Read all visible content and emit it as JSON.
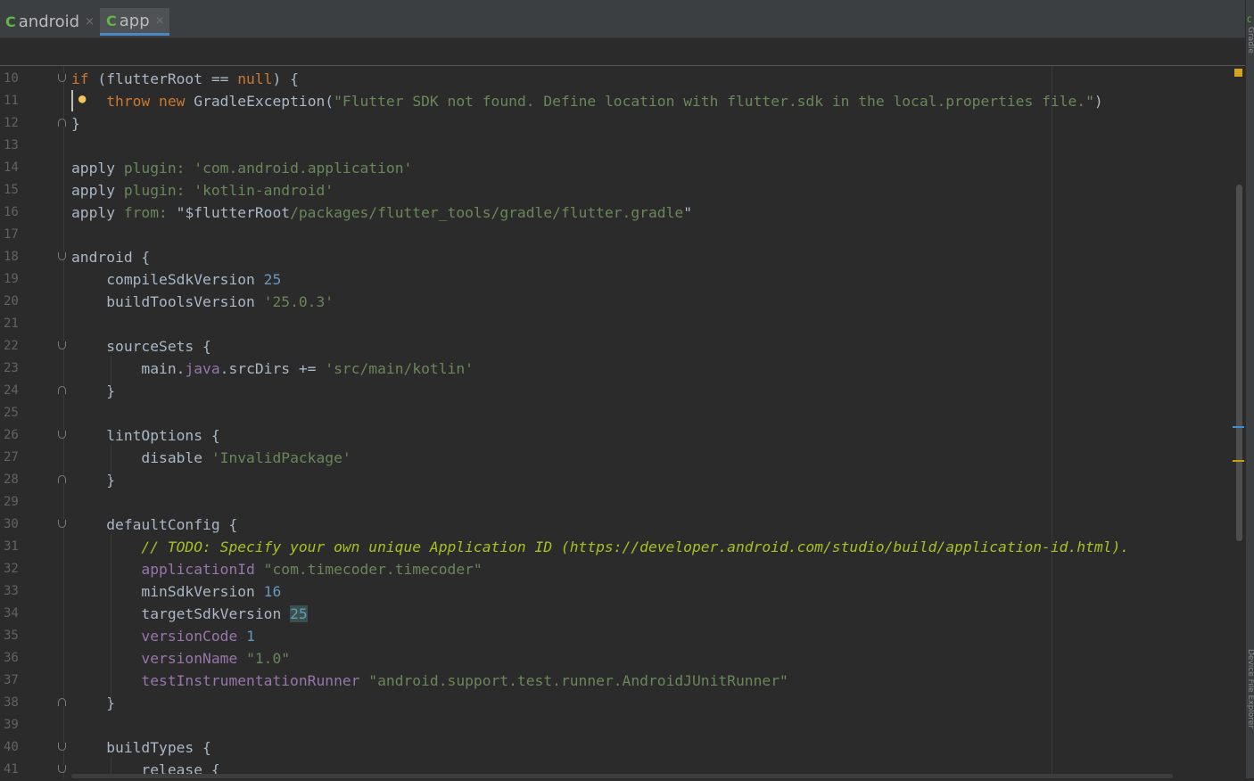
{
  "tabs": [
    {
      "label": "android",
      "close": "×",
      "icon": "gradle-c-icon",
      "active": false
    },
    {
      "label": "app",
      "close": "×",
      "icon": "gradle-c-icon",
      "active": true
    }
  ],
  "side_panel": {
    "top_label": "Gradle",
    "bottom_label": "Device File Explorer"
  },
  "colors": {
    "background": "#2b2b2b",
    "keyword": "#cc7832",
    "string": "#6a8759",
    "number": "#6897bb",
    "property": "#9876aa",
    "todo": "#a8c023",
    "text": "#a9b7c6"
  },
  "code": {
    "lines": [
      {
        "num": "10",
        "tokens": [
          {
            "t": "if",
            "c": "keyword"
          },
          {
            "t": " (flutterRoot == "
          },
          {
            "t": "null",
            "c": "keyword"
          },
          {
            "t": ") {"
          }
        ]
      },
      {
        "num": "11",
        "tokens": [
          {
            "t": "    "
          },
          {
            "t": "throw",
            "c": "keyword"
          },
          {
            "t": " "
          },
          {
            "t": "new",
            "c": "keyword"
          },
          {
            "t": " GradleException("
          },
          {
            "t": "\"Flutter SDK not found. Define location with flutter.sdk in the local.properties file.\"",
            "c": "string"
          },
          {
            "t": ")"
          }
        ]
      },
      {
        "num": "12",
        "tokens": [
          {
            "t": "}"
          }
        ]
      },
      {
        "num": "13",
        "tokens": []
      },
      {
        "num": "14",
        "tokens": [
          {
            "t": "apply "
          },
          {
            "t": "plugin:",
            "c": "string"
          },
          {
            "t": " "
          },
          {
            "t": "'com.android.application'",
            "c": "string"
          }
        ]
      },
      {
        "num": "15",
        "tokens": [
          {
            "t": "apply "
          },
          {
            "t": "plugin:",
            "c": "string"
          },
          {
            "t": " "
          },
          {
            "t": "'kotlin-android'",
            "c": "string"
          }
        ]
      },
      {
        "num": "16",
        "tokens": [
          {
            "t": "apply "
          },
          {
            "t": "from:",
            "c": "string"
          },
          {
            "t": " \"$flutterRoot"
          },
          {
            "t": "/packages/flutter_tools/gradle/flutter.gradle",
            "c": "string"
          },
          {
            "t": "\""
          }
        ]
      },
      {
        "num": "17",
        "tokens": []
      },
      {
        "num": "18",
        "tokens": [
          {
            "t": "android {"
          }
        ]
      },
      {
        "num": "19",
        "tokens": [
          {
            "t": "    compileSdkVersion "
          },
          {
            "t": "25",
            "c": "number"
          }
        ]
      },
      {
        "num": "20",
        "tokens": [
          {
            "t": "    buildToolsVersion "
          },
          {
            "t": "'25.0.3'",
            "c": "string"
          }
        ]
      },
      {
        "num": "21",
        "tokens": []
      },
      {
        "num": "22",
        "tokens": [
          {
            "t": "    sourceSets {"
          }
        ]
      },
      {
        "num": "23",
        "tokens": [
          {
            "t": "        main."
          },
          {
            "t": "java",
            "c": "property"
          },
          {
            "t": ".srcDirs += "
          },
          {
            "t": "'src/main/kotlin'",
            "c": "string"
          }
        ]
      },
      {
        "num": "24",
        "tokens": [
          {
            "t": "    }"
          }
        ]
      },
      {
        "num": "25",
        "tokens": []
      },
      {
        "num": "26",
        "tokens": [
          {
            "t": "    lintOptions {"
          }
        ]
      },
      {
        "num": "27",
        "tokens": [
          {
            "t": "        disable "
          },
          {
            "t": "'InvalidPackage'",
            "c": "string"
          }
        ]
      },
      {
        "num": "28",
        "tokens": [
          {
            "t": "    }"
          }
        ]
      },
      {
        "num": "29",
        "tokens": []
      },
      {
        "num": "30",
        "tokens": [
          {
            "t": "    defaultConfig {"
          }
        ]
      },
      {
        "num": "31",
        "tokens": [
          {
            "t": "        // ",
            "c": "comment"
          },
          {
            "t": "TODO: Specify your own unique Application ID (https://developer.android.com/studio/build/application-id.html).",
            "c": "todo"
          }
        ]
      },
      {
        "num": "32",
        "tokens": [
          {
            "t": "        "
          },
          {
            "t": "applicationId",
            "c": "property"
          },
          {
            "t": " "
          },
          {
            "t": "\"com.timecoder.timecoder\"",
            "c": "string"
          }
        ]
      },
      {
        "num": "33",
        "tokens": [
          {
            "t": "        minSdkVersion "
          },
          {
            "t": "16",
            "c": "number"
          }
        ]
      },
      {
        "num": "34",
        "tokens": [
          {
            "t": "        targetSdkVersion "
          },
          {
            "t": "25",
            "c": "numberhl"
          }
        ]
      },
      {
        "num": "35",
        "tokens": [
          {
            "t": "        "
          },
          {
            "t": "versionCode",
            "c": "property"
          },
          {
            "t": " "
          },
          {
            "t": "1",
            "c": "number"
          }
        ]
      },
      {
        "num": "36",
        "tokens": [
          {
            "t": "        "
          },
          {
            "t": "versionName",
            "c": "property"
          },
          {
            "t": " "
          },
          {
            "t": "\"1.0\"",
            "c": "string"
          }
        ]
      },
      {
        "num": "37",
        "tokens": [
          {
            "t": "        "
          },
          {
            "t": "testInstrumentationRunner",
            "c": "property"
          },
          {
            "t": " "
          },
          {
            "t": "\"android.support.test.runner.AndroidJUnitRunner\"",
            "c": "string"
          }
        ]
      },
      {
        "num": "38",
        "tokens": [
          {
            "t": "    }"
          }
        ]
      },
      {
        "num": "39",
        "tokens": []
      },
      {
        "num": "40",
        "tokens": [
          {
            "t": "    buildTypes {"
          }
        ]
      },
      {
        "num": "41",
        "tokens": [
          {
            "t": "        release {"
          }
        ]
      }
    ]
  }
}
